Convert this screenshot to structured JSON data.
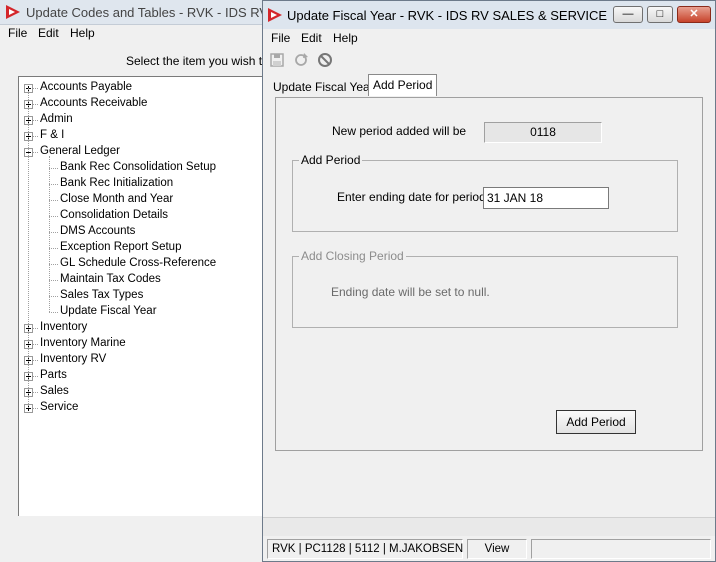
{
  "bg_window": {
    "title": "Update Codes and Tables - RVK - IDS RV SAL",
    "menu": [
      "File",
      "Edit",
      "Help"
    ],
    "prompt": "Select the item you wish to u",
    "tree": [
      {
        "label": "Accounts Payable",
        "level": 0,
        "expander": "plus"
      },
      {
        "label": "Accounts Receivable",
        "level": 0,
        "expander": "plus"
      },
      {
        "label": "Admin",
        "level": 0,
        "expander": "plus"
      },
      {
        "label": "F & I",
        "level": 0,
        "expander": "plus"
      },
      {
        "label": "General Ledger",
        "level": 0,
        "expander": "minus"
      },
      {
        "label": "Bank Rec Consolidation Setup",
        "level": 1
      },
      {
        "label": "Bank Rec Initialization",
        "level": 1
      },
      {
        "label": "Close Month and Year",
        "level": 1
      },
      {
        "label": "Consolidation Details",
        "level": 1
      },
      {
        "label": "DMS Accounts",
        "level": 1
      },
      {
        "label": "Exception Report Setup",
        "level": 1
      },
      {
        "label": "GL Schedule Cross-Reference",
        "level": 1
      },
      {
        "label": "Maintain Tax Codes",
        "level": 1
      },
      {
        "label": "Sales Tax Types",
        "level": 1
      },
      {
        "label": "Update Fiscal Year",
        "level": 1
      },
      {
        "label": "Inventory",
        "level": 0,
        "expander": "plus"
      },
      {
        "label": "Inventory Marine",
        "level": 0,
        "expander": "plus"
      },
      {
        "label": "Inventory RV",
        "level": 0,
        "expander": "plus"
      },
      {
        "label": "Parts",
        "level": 0,
        "expander": "plus"
      },
      {
        "label": "Sales",
        "level": 0,
        "expander": "plus"
      },
      {
        "label": "Service",
        "level": 0,
        "expander": "plus"
      }
    ]
  },
  "dialog": {
    "title": "Update Fiscal Year - RVK - IDS RV SALES & SERVICE",
    "menu": [
      "File",
      "Edit",
      "Help"
    ],
    "toolbar_icons": [
      "save-icon",
      "refresh-icon",
      "cancel-icon"
    ],
    "tabs": [
      {
        "label": "Update Fiscal Year",
        "active": false
      },
      {
        "label": "Add Period",
        "active": true
      }
    ],
    "new_period_label": "New period added will be",
    "new_period_value": "0118",
    "add_group_label": "Add Period",
    "ending_date_label": "Enter ending date for period",
    "ending_date_value": "31 JAN 18",
    "closing_group_label": "Add Closing Period",
    "closing_note": "Ending date will be set to null.",
    "add_button_label": "Add Period",
    "status": {
      "user": "RVK | PC1128 | 5112 | M.JAKOBSEN",
      "mode": "View",
      "extra": ""
    }
  },
  "colors": {
    "logo": "#d4262b",
    "close_button": "#c7432b",
    "title_bar": "#dde5ee"
  }
}
